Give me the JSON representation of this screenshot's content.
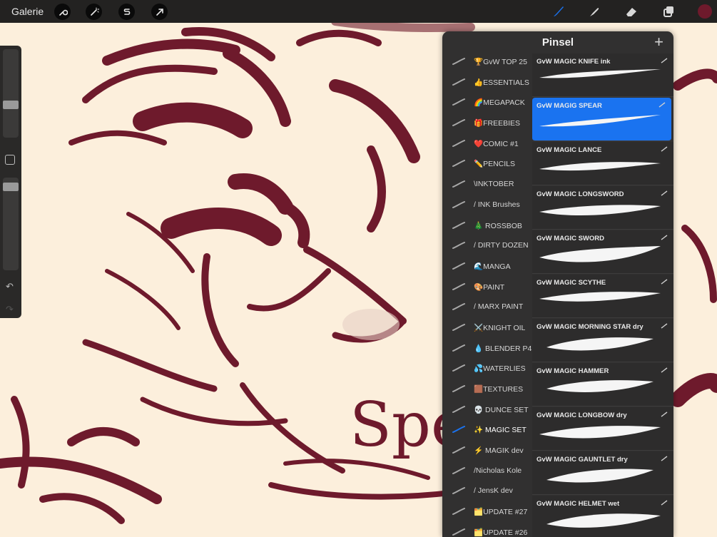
{
  "app": {
    "gallery_label": "Galerie"
  },
  "toolbar": {
    "left_tools": [
      "wrench-icon",
      "magic-wand-icon",
      "selection-icon",
      "transform-arrow-icon"
    ],
    "right_tools": [
      "brush-icon",
      "smudge-icon",
      "eraser-icon",
      "layers-icon"
    ],
    "accent": "#1a73f0",
    "current_color": "#6e1a2c"
  },
  "canvas": {
    "background": "#fcefdc",
    "ink": "#6e1a2c",
    "text": "Spea"
  },
  "panel": {
    "title": "Pinsel",
    "add_label": "+",
    "sets": [
      {
        "label": "🏆GvW TOP 25"
      },
      {
        "label": "👍ESSENTIALS"
      },
      {
        "label": "🌈MEGAPACK"
      },
      {
        "label": "🎁FREEBIES"
      },
      {
        "label": "❤️COMIC #1"
      },
      {
        "label": "✏️PENCILS"
      },
      {
        "label": "\\INKTOBER"
      },
      {
        "label": "/ INK Brushes"
      },
      {
        "label": "🎄 ROSSBOB"
      },
      {
        "label": "/ DIRTY DOZEN"
      },
      {
        "label": "🌊MANGA"
      },
      {
        "label": "🎨PAINT"
      },
      {
        "label": "/ MARX PAINT"
      },
      {
        "label": "⚔️KNIGHT OIL"
      },
      {
        "label": "💧 BLENDER P4"
      },
      {
        "label": "💦WATERLIES"
      },
      {
        "label": "🟫TEXTURES"
      },
      {
        "label": "💀 DUNCE SET"
      },
      {
        "label": "✨ MAGIC SET",
        "active": true
      },
      {
        "label": "⚡ MAGIK dev"
      },
      {
        "label": "/Nicholas Kole"
      },
      {
        "label": "/ JensK dev"
      },
      {
        "label": "🗂️UPDATE #27"
      },
      {
        "label": "🗂️UPDATE #26"
      }
    ],
    "brushes": [
      {
        "name": "GvW MAGIC KNIFE ink"
      },
      {
        "name": "GvW MAGIG SPEAR",
        "selected": true
      },
      {
        "name": "GvW MAGIC LANCE"
      },
      {
        "name": "GvW MAGIC LONGSWORD"
      },
      {
        "name": "GvW MAGIC SWORD"
      },
      {
        "name": "GvW MAGIC SCYTHE"
      },
      {
        "name": "GvW MAGIC MORNING STAR dry"
      },
      {
        "name": "GvW MAGIC HAMMER"
      },
      {
        "name": "GvW MAGIC LONGBOW dry"
      },
      {
        "name": "GvW MAGIC GAUNTLET dry"
      },
      {
        "name": "GvW MAGIC HELMET wet"
      }
    ]
  }
}
